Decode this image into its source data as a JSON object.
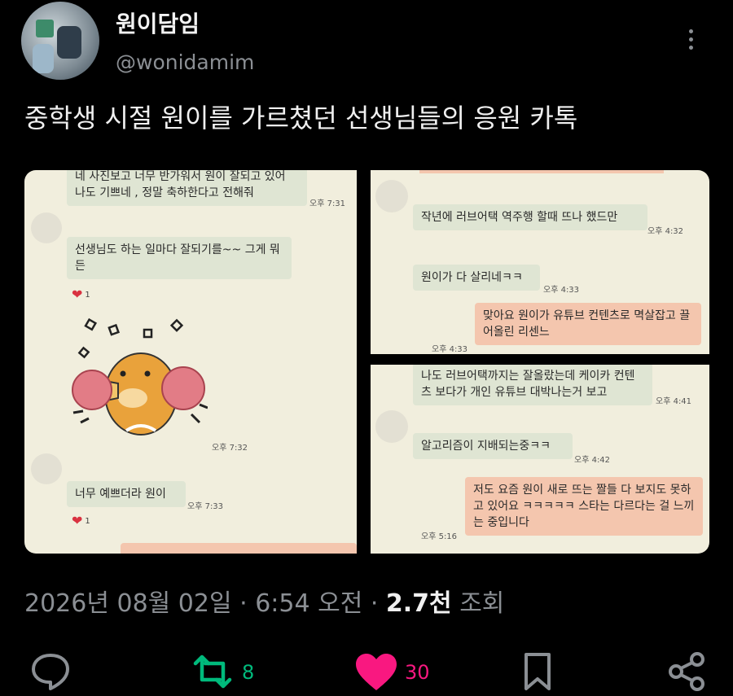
{
  "profile": {
    "display_name": "원이담임",
    "handle": "@wonidamim"
  },
  "tweet": {
    "text": "중학생 시절 원이를 가르쳤던 선생님들의 응원 카톡"
  },
  "chat_left": {
    "bubble1": "네 사진보고 너무 반가워서 원이 잘되고 있어 나도 기쁘네 , 정말 축하한다고 전해줘",
    "time1": "오후 7:31",
    "bubble2": "선생님도 하는 일마다  잘되기를~~  그게 뭐든",
    "reaction1": "1",
    "time2": "오후 7:32",
    "bubble3": "너무 예쁘더라 원이",
    "time3": "오후 7:33",
    "reaction2": "1"
  },
  "chat_right_top": {
    "bubble1": "작년에 러브어택 역주행 할때 뜨나 했드만",
    "time1": "오후 4:32",
    "bubble2": "원이가 다 살리네ㅋㅋ",
    "time2": "오후 4:33",
    "bubble3": "맞아요 원이가 유튜브 컨텐츠로 멱살잡고 끌어올린 리센느",
    "time3": "오후 4:33"
  },
  "chat_right_bottom": {
    "bubble1": "나도 러브어택까지는 잘올랐는데 케이카 컨텐츠 보다가 개인 유튜브 대박나는거 보고",
    "time1": "오후 4:41",
    "bubble2": "알고리즘이 지배되는중ㅋㅋ",
    "time2": "오후 4:42",
    "bubble3": "저도 요즘 원이 새로 뜨는 짤들 다 보지도 못하고 있어요 ㅋㅋㅋㅋㅋ 스타는 다르다는 걸 느끼는 중입니다",
    "time3": "오후 5:16"
  },
  "meta": {
    "date": "2026년 08월 02일",
    "sep1": " · ",
    "time": "6:54 오전",
    "sep2": " · ",
    "views": "2.7천",
    "views_label": " 조회"
  },
  "actions": {
    "retweet_count": "8",
    "like_count": "30"
  },
  "colors": {
    "like": "#f91880",
    "retweet": "#00ba7c",
    "icon": "#8b8f94",
    "chat_bg": "#f1eedd",
    "bubble_green": "#dfe5d3",
    "bubble_peach": "#f4c6ae"
  },
  "icons": [
    "reply-icon",
    "retweet-icon",
    "heart-icon",
    "bookmark-icon",
    "share-icon",
    "more-icon"
  ]
}
